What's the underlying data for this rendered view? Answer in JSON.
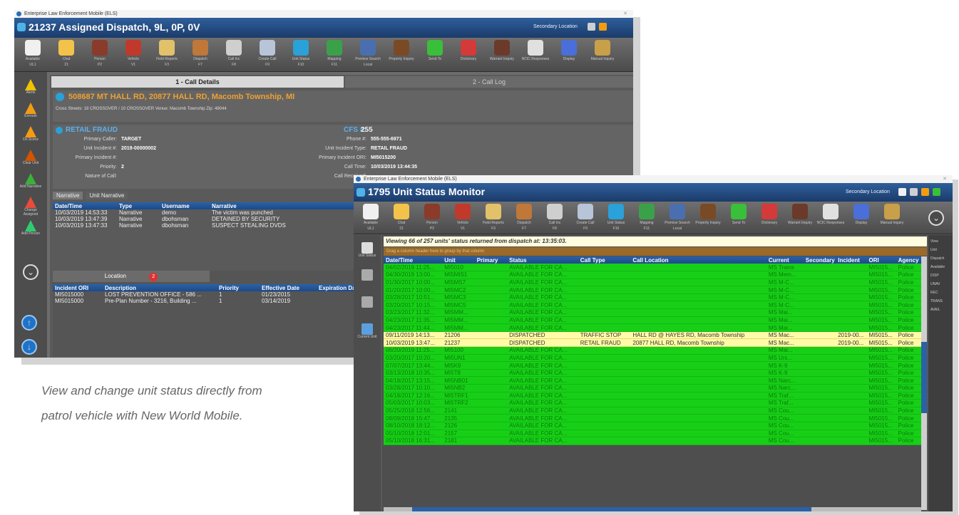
{
  "caption": {
    "line1": "View and change unit status directly from",
    "line2": "patrol vehicle with New World Mobile."
  },
  "win1": {
    "os_title": "Enterprise Law Enforcement Mobile (ELS)",
    "title": "21237  Assigned Dispatch, 9L, 0P, 0V",
    "location_label": "Secondary Location",
    "toolbar": [
      {
        "label": "Available",
        "n": "UL1",
        "color": "#f0f0f0"
      },
      {
        "label": "Chat",
        "n": "21",
        "color": "#f3c24a"
      },
      {
        "label": "Person",
        "n": "P2",
        "color": "#8a3b2a"
      },
      {
        "label": "Vehicle",
        "n": "V1",
        "color": "#c0392b"
      },
      {
        "label": "Field Reports",
        "n": "F3",
        "color": "#e2c16b"
      },
      {
        "label": "Dispatch",
        "n": "F7",
        "color": "#c0773a"
      },
      {
        "label": "Call Inc",
        "n": "F8",
        "color": "#cfcfcf"
      },
      {
        "label": "Create Call",
        "n": "F9",
        "color": "#b8c4d8"
      },
      {
        "label": "Unit Status",
        "n": "F10",
        "color": "#2aa1d8"
      },
      {
        "label": "Mapping",
        "n": "F11",
        "color": "#3aa14a"
      },
      {
        "label": "Premise Search",
        "n": "Local",
        "color": "#4a6fb0"
      },
      {
        "label": "Property Inquiry",
        "n": "",
        "color": "#7a4a26"
      },
      {
        "label": "Send To",
        "n": "",
        "color": "#3abf3a"
      },
      {
        "label": "Dictionary",
        "n": "",
        "color": "#d43a3a"
      },
      {
        "label": "Warrant Inquiry",
        "n": "",
        "color": "#6b3a2a"
      },
      {
        "label": "NCIC Responses",
        "n": "",
        "color": "#e0e0e0"
      },
      {
        "label": "Display",
        "n": "",
        "color": "#4a6fd8"
      },
      {
        "label": "Manual Inquiry",
        "n": "",
        "color": "#c8a04a"
      }
    ],
    "sidebar": [
      {
        "label": "Alerts",
        "color": "#f2c200"
      },
      {
        "label": "Enroute",
        "color": "#f39c12"
      },
      {
        "label": "On Scene",
        "color": "#f39c12"
      },
      {
        "label": "Clear Unit",
        "color": "#d35400"
      },
      {
        "label": "Add Narrative",
        "color": "#3bb03b"
      },
      {
        "label": "Change Assigned",
        "color": "#e74c3c"
      },
      {
        "label": "Add Person",
        "color": "#2ecc71"
      }
    ],
    "tabs": {
      "details": "1 - Call Details",
      "log": "2 - Call Log"
    },
    "address": "508687 MT HALL RD, 20877 HALL RD, Macomb Township, MI",
    "cross_line": "Cross Streets: 18 CROSSOVER / 10 CROSSOVER  Venue: Macomb Township  Zip: 48044",
    "nature": "RETAIL FRAUD",
    "cfs_label": "CFS #:",
    "cfs": "255",
    "left_fields": [
      {
        "k": "Primary Caller:",
        "v": "TARGET"
      },
      {
        "k": "Unit Incident #:",
        "v": "2019-00000002"
      },
      {
        "k": "Primary Incident #:",
        "v": ""
      },
      {
        "k": "Priority:",
        "v": "2"
      },
      {
        "k": "Nature of Call:",
        "v": ""
      }
    ],
    "right_fields": [
      {
        "k": "Phone #:",
        "v": "555-555-6971"
      },
      {
        "k": "Unit Incident Type:",
        "v": "RETAIL FRAUD"
      },
      {
        "k": "Primary Incident ORI:",
        "v": "MI5015200"
      },
      {
        "k": "Call Time:",
        "v": "10/03/2019 13:44:35"
      },
      {
        "k": "Call Received:",
        "v": ""
      }
    ],
    "subtabs": [
      "Narrative",
      "Unit Narrative"
    ],
    "narr_headers": [
      "Date/Time",
      "Type",
      "Username",
      "Narrative"
    ],
    "narr_rows": [
      [
        "10/03/2019 14:53:33",
        "Narrative",
        "demo",
        "The victim was punched"
      ],
      [
        "10/03/2019 13:47:39",
        "Narrative",
        "dbohsman",
        "DETAINED BY SECURITY"
      ],
      [
        "10/03/2019 13:47:33",
        "Narrative",
        "dbohsman",
        "SUSPECT STEALING DVDS"
      ]
    ],
    "location_tab": "Location",
    "location_count": "2",
    "loc_headers": [
      "Incident ORI",
      "Description",
      "Priority",
      "Effective Date",
      "Expiration Date"
    ],
    "loc_rows": [
      [
        "MI5015000",
        "LOST PREVENTION OFFICE - 586 ...",
        "1",
        "01/23/2015",
        ""
      ],
      [
        "MI5015000",
        "Pre-Plan Number - 3216, Building ...",
        "1",
        "03/14/2019",
        ""
      ]
    ]
  },
  "win2": {
    "os_title": "Enterprise Law Enforcement Mobile (ELS)",
    "title": "1795  Unit Status Monitor",
    "location_label": "Secondary Location",
    "sidebar": [
      {
        "label": "Unit Status",
        "color": "#dddddd"
      },
      {
        "label": "",
        "color": "#aaaaaa"
      },
      {
        "label": "",
        "color": "#aaaaaa"
      },
      {
        "label": "Current Unit",
        "color": "#5aa0e0"
      }
    ],
    "banner": "Viewing 66 of 257 units' status returned from dispatch at: 13:35:03.",
    "banner_sub": "Drag a column header here to group by that column",
    "headers": [
      "Date/Time",
      "Unit",
      "Primary",
      "Status",
      "Call Type",
      "Call Location",
      "Current",
      "Secondary",
      "Incident",
      "ORI",
      "Agency"
    ],
    "rows": [
      [
        "04/02/2019 11:25...",
        "MI5010",
        "",
        "AVAILABLE FOR CA...",
        "",
        "",
        "MS Trains",
        "",
        "",
        "MI5015...",
        "Police",
        "g"
      ],
      [
        "04/30/2019 13:00...",
        "MI5MIS1",
        "",
        "AVAILABLE FOR CA...",
        "",
        "",
        "MS Mem...",
        "",
        "",
        "MI5015...",
        "Police",
        "g"
      ],
      [
        "01/30/2017 10:00...",
        "MI5MS7",
        "",
        "AVAILABLE FOR CA...",
        "",
        "",
        "MS M-C...",
        "",
        "",
        "MI5015...",
        "Police",
        "g"
      ],
      [
        "01/20/2017 10:00...",
        "MI5MC2",
        "",
        "AVAILABLE FOR CA...",
        "",
        "",
        "MS M-C...",
        "",
        "",
        "MI5015...",
        "Police",
        "g"
      ],
      [
        "03/28/2017 10:51...",
        "MI5MC3",
        "",
        "AVAILABLE FOR CA...",
        "",
        "",
        "MS M-C...",
        "",
        "",
        "MI5015...",
        "Police",
        "g"
      ],
      [
        "03/20/2017 10:15...",
        "MI5MC5",
        "",
        "AVAILABLE FOR CA...",
        "",
        "",
        "MS M-C...",
        "",
        "",
        "MI5015...",
        "Police",
        "g"
      ],
      [
        "03/23/2017 11:32...",
        "MI5MM...",
        "",
        "AVAILABLE FOR CA...",
        "",
        "",
        "MS Mai...",
        "",
        "",
        "MI5015...",
        "Police",
        "g"
      ],
      [
        "04/23/2017 11:35...",
        "MI5MM...",
        "",
        "AVAILABLE FOR CA...",
        "",
        "",
        "MS Mai...",
        "",
        "",
        "MI5015...",
        "Police",
        "g"
      ],
      [
        "04/23/2017 11:44...",
        "MI5MM...",
        "",
        "AVAILABLE FOR CA...",
        "",
        "",
        "MS Mai...",
        "",
        "",
        "MI5015...",
        "Police",
        "g"
      ],
      [
        "09/11/2019 14:13...",
        "21206",
        "",
        "DISPATCHED",
        "TRAFFIC STOP",
        "HALL RD @ HAYES RD, Macomb Township",
        "MS Mac...",
        "",
        "2019-00...",
        "MI5015...",
        "Police",
        "y"
      ],
      [
        "10/03/2019 13:47...",
        "21237",
        "",
        "DISPATCHED",
        "RETAIL FRAUD",
        "20877 HALL RD, Macomb Township",
        "MS Mac...",
        "",
        "2019-00...",
        "MI5015...",
        "Police",
        "y"
      ],
      [
        "06/20/2019 11:25...",
        "MI5100",
        "",
        "AVAILABLE FOR CA...",
        "",
        "",
        "MS Mai...",
        "",
        "",
        "MI5015...",
        "Police",
        "g"
      ],
      [
        "03/20/2017 10:20...",
        "MI5UN1",
        "",
        "AVAILABLE FOR CA...",
        "",
        "",
        "MS Uni...",
        "",
        "",
        "MI5015...",
        "Police",
        "g"
      ],
      [
        "07/07/2017 13:44...",
        "MI5K9",
        "",
        "AVAILABLE FOR CA...",
        "",
        "",
        "MS K-9",
        "",
        "",
        "MI5015...",
        "Police",
        "g"
      ],
      [
        "03/13/2018 10:35...",
        "MI5T8",
        "",
        "AVAILABLE FOR CA...",
        "",
        "",
        "MS K-9",
        "",
        "",
        "MI5015...",
        "Police",
        "g"
      ],
      [
        "04/18/2017 13:15...",
        "MI5NB01",
        "",
        "AVAILABLE FOR CA...",
        "",
        "",
        "MS Narc...",
        "",
        "",
        "MI5015...",
        "Police",
        "g"
      ],
      [
        "03/28/2017 10:10...",
        "MI5NB2",
        "",
        "AVAILABLE FOR CA...",
        "",
        "",
        "MS Narc...",
        "",
        "",
        "MI5015...",
        "Police",
        "g"
      ],
      [
        "04/18/2017 12:16...",
        "MI5TRF1",
        "",
        "AVAILABLE FOR CA...",
        "",
        "",
        "MS Traf...",
        "",
        "",
        "MI5015...",
        "Police",
        "g"
      ],
      [
        "05/03/2017 10:03...",
        "MI5TRF2",
        "",
        "AVAILABLE FOR CA...",
        "",
        "",
        "MS Traf...",
        "",
        "",
        "MI5015...",
        "Police",
        "g"
      ],
      [
        "05/25/2018 12:56...",
        "2141",
        "",
        "AVAILABLE FOR CA...",
        "",
        "",
        "MS Cou...",
        "",
        "",
        "MI5015...",
        "Police",
        "g"
      ],
      [
        "08/09/2018 15:47...",
        "2135",
        "",
        "AVAILABLE FOR CA...",
        "",
        "",
        "MS Cou...",
        "",
        "",
        "MI5015...",
        "Police",
        "g"
      ],
      [
        "08/10/2018 18:12...",
        "2126",
        "",
        "AVAILABLE FOR CA...",
        "",
        "",
        "MS Cou...",
        "",
        "",
        "MI5015...",
        "Police",
        "g"
      ],
      [
        "05/10/2018 12:01...",
        "2157",
        "",
        "AVAILABLE FOR CA...",
        "",
        "",
        "MS Cou...",
        "",
        "",
        "MI5015...",
        "Police",
        "g"
      ],
      [
        "05/10/2018 16:31...",
        "2181",
        "",
        "AVAILABLE FOR CA...",
        "",
        "",
        "MS Cou...",
        "",
        "",
        "MI5015...",
        "Police",
        "g"
      ]
    ],
    "right_items": [
      "View",
      "Unit",
      "Dispatch",
      "Available",
      "DISP",
      "UNAV",
      "REC",
      "TRANS",
      "AVAIL"
    ]
  }
}
